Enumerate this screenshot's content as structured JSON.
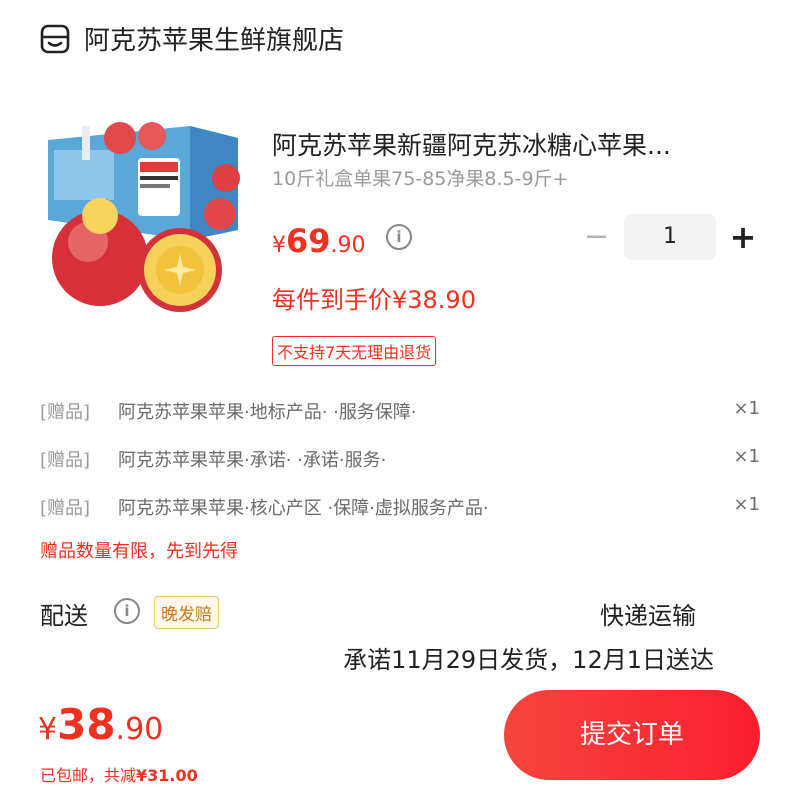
{
  "store": {
    "name": "阿克苏苹果生鲜旗舰店",
    "icon": "store-icon"
  },
  "product": {
    "title": "阿克苏苹果新疆阿克苏冰糖心苹果...",
    "spec": "10斤礼盒单果75-85净果8.5-9斤+",
    "price": {
      "symbol": "¥",
      "int": "69",
      "dec": ".90"
    },
    "net_price": "每件到手价¥38.90",
    "no_return": "不支持7天无理由退货",
    "quantity": "1",
    "image_icon": "apple-gift-box-image"
  },
  "gifts": [
    {
      "tag": "[赠品]",
      "name": "阿克苏苹果苹果·地标产品· ·服务保障·",
      "qty": "×1"
    },
    {
      "tag": "[赠品]",
      "name": "阿克苏苹果苹果·承诺· ·承诺·服务·",
      "qty": "×1"
    },
    {
      "tag": "[赠品]",
      "name": "阿克苏苹果苹果·核心产区 ·保障·虚拟服务产品·",
      "qty": "×1"
    }
  ],
  "gift_limit": "赠品数量有限，先到先得",
  "shipping": {
    "label": "配送",
    "badge": "晚发赔",
    "method": "快递运输",
    "promise": "承诺11月29日发货，12月1日送达"
  },
  "total": {
    "symbol": "¥",
    "int": "38",
    "dec": ".90",
    "shipping_free": "已包邮，",
    "saved_prefix": "共减",
    "saved": "¥31.00"
  },
  "submit_label": "提交订单",
  "colors": {
    "accent": "#f2301f",
    "muted": "#9a9a9a"
  }
}
